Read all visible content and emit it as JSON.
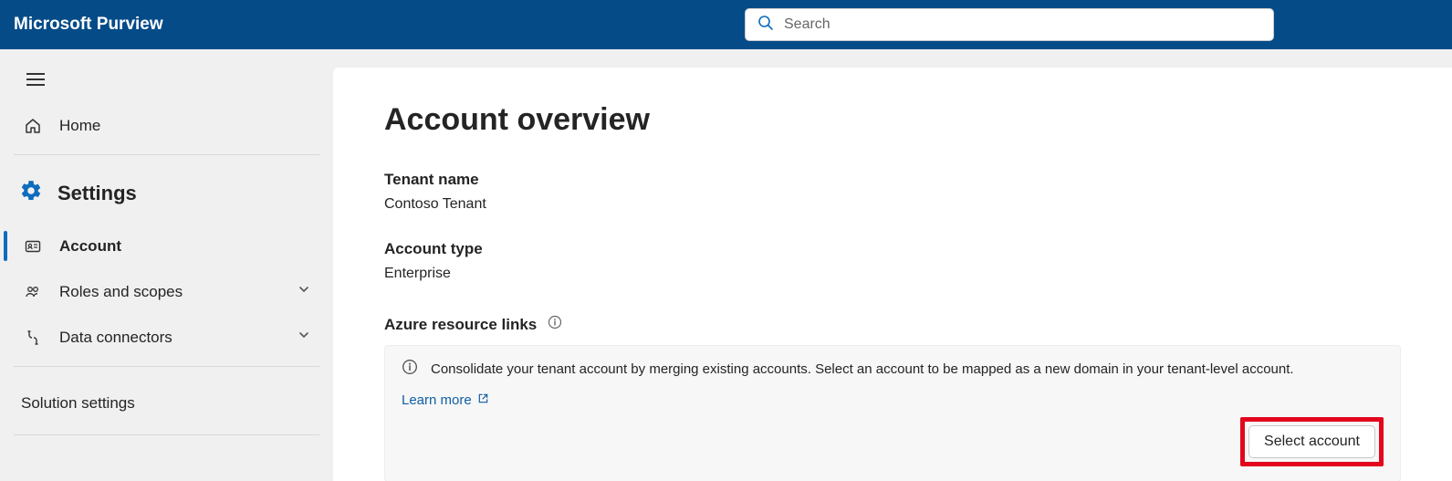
{
  "header": {
    "product": "Microsoft Purview",
    "search_placeholder": "Search"
  },
  "sidebar": {
    "home_label": "Home",
    "settings_header": "Settings",
    "items": {
      "account": "Account",
      "roles": "Roles and scopes",
      "connectors": "Data connectors"
    },
    "solution_settings": "Solution settings"
  },
  "main": {
    "title": "Account overview",
    "tenant_name_label": "Tenant name",
    "tenant_name_value": "Contoso Tenant",
    "account_type_label": "Account type",
    "account_type_value": "Enterprise",
    "azure_links_label": "Azure resource links",
    "banner_text": "Consolidate your tenant account by merging existing accounts. Select an account to be mapped as a new domain in your tenant-level account.",
    "learn_more": "Learn more",
    "select_account_btn": "Select account"
  }
}
